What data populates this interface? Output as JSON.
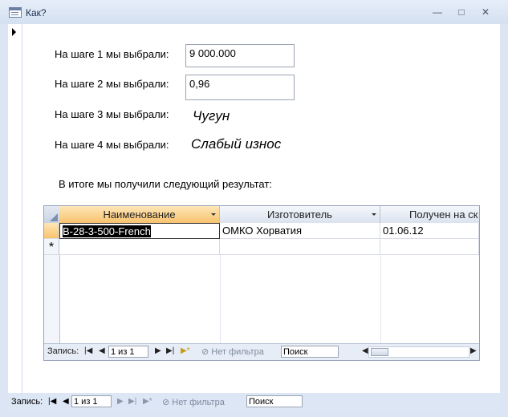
{
  "window": {
    "title": "Как?",
    "min_glyph": "—",
    "max_glyph": "□",
    "close_glyph": "✕"
  },
  "form": {
    "steps": [
      {
        "label": "На шаге 1 мы выбрали:",
        "value": "9 000.000"
      },
      {
        "label": "На шаге 2 мы выбрали:",
        "value": "0,96"
      },
      {
        "label": "На шаге 3 мы выбрали:",
        "value": "Чугун"
      },
      {
        "label": "На шаге 4 мы выбрали:",
        "value": "Слабый износ"
      }
    ],
    "result_label": "В итоге мы получили следующий результат:"
  },
  "datasheet": {
    "columns": [
      "Наименование",
      "Изготовитель",
      "Получен на ск"
    ],
    "rows": [
      {
        "name": "B-28-3-500-French",
        "maker": "ОМКО Хорватия",
        "received": "01.06.12"
      }
    ],
    "new_row_marker": "*",
    "nav": {
      "record_label": "Запись:",
      "position": "1 из 1",
      "filter": "Нет фильтра",
      "search": "Поиск"
    }
  },
  "outer_nav": {
    "record_label": "Запись:",
    "position": "1 из 1",
    "filter": "Нет фильтра",
    "search": "Поиск"
  }
}
